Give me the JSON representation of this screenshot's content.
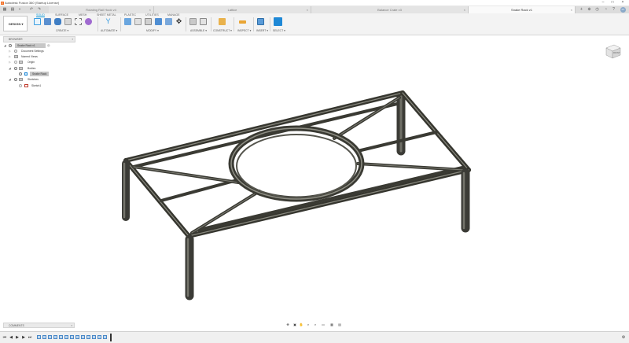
{
  "app": {
    "title": "Autodesk Fusion 360 (Startup License)"
  },
  "doc_tabs": [
    {
      "label": "Rotating Rail Hook v4",
      "active": false
    },
    {
      "label": "Lattice",
      "active": false
    },
    {
      "label": "Balance Crate v3",
      "active": false
    },
    {
      "label": "Snake Rack v1",
      "active": true
    }
  ],
  "ribbon": {
    "workspace": "DESIGN ▾",
    "tabs": [
      "SOLID",
      "SURFACE",
      "MESH",
      "SHEET METAL",
      "PLASTIC",
      "UTILITIES",
      "MANAGE"
    ],
    "active_tab": "SOLID",
    "groups": [
      "CREATE ▾",
      "AUTOMATE ▾",
      "MODIFY ▾",
      "ASSEMBLE ▾",
      "CONSTRUCT ▾",
      "INSPECT ▾",
      "INSERT ▾",
      "SELECT ▾"
    ]
  },
  "user": {
    "initials": "KT"
  },
  "browser": {
    "title": "BROWSER",
    "root": "Snake Rack v1",
    "items": [
      {
        "label": "Document Settings",
        "indent": 1
      },
      {
        "label": "Named Views",
        "indent": 1
      },
      {
        "label": "Origin",
        "indent": 1
      },
      {
        "label": "Bodies",
        "indent": 1
      },
      {
        "label": "Snake Rack",
        "indent": 2
      },
      {
        "label": "Sketches",
        "indent": 1
      },
      {
        "label": "Sketch1",
        "indent": 2
      }
    ]
  },
  "viewcube": {
    "label": "FRONT"
  },
  "comments": {
    "title": "COMMENTS"
  },
  "colors": {
    "accent": "#0696d7",
    "model": "#4a4a44"
  }
}
